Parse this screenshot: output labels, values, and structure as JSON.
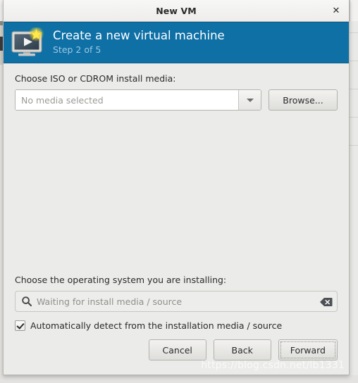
{
  "window": {
    "title": "New VM",
    "close_label": "✕",
    "close_icon": "close-icon"
  },
  "banner": {
    "icon": "new-virtual-machine-icon",
    "title": "Create a new virtual machine",
    "subtitle": "Step 2 of 5",
    "background_color": "#0f70a6",
    "subtitle_color": "#9cc8e0"
  },
  "media": {
    "label": "Choose ISO or CDROM install media:",
    "combo_value": "No media selected",
    "combo_arrow_icon": "chevron-down-icon",
    "browse_label": "Browse..."
  },
  "os": {
    "label": "Choose the operating system you are installing:",
    "search_placeholder": "Waiting for install media / source",
    "search_value": "",
    "search_icon": "search-icon",
    "clear_icon": "clear-backspace-icon",
    "autodetect_label": "Automatically detect from the installation media / source",
    "autodetect_checked": true
  },
  "footer": {
    "cancel_label": "Cancel",
    "back_label": "Back",
    "forward_label": "Forward",
    "forward_focused": true
  },
  "watermark": {
    "text": "https://blog.csdn.net/lb1331"
  }
}
